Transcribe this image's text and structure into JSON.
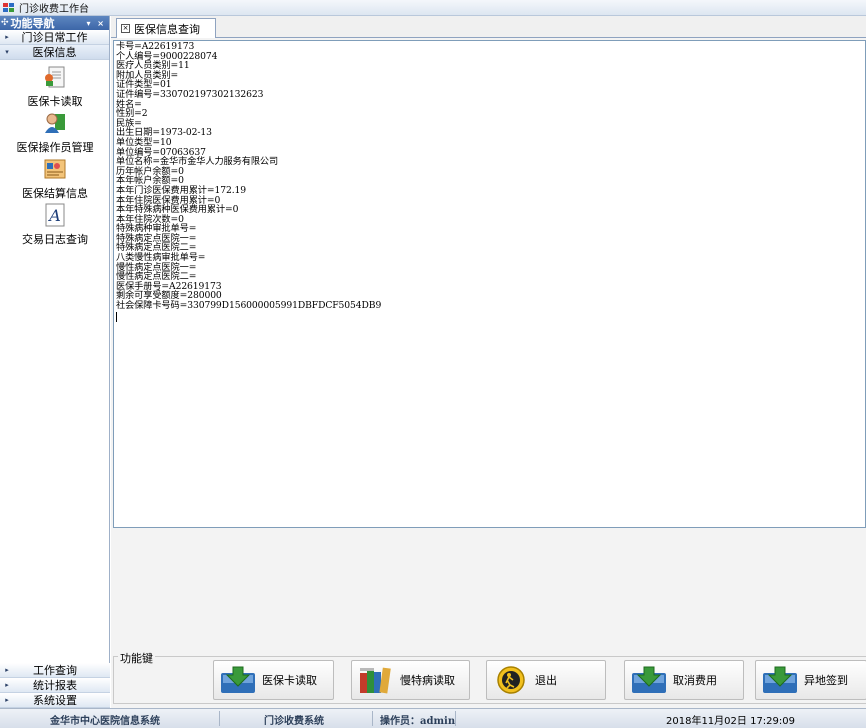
{
  "window": {
    "title": "门诊收费工作台"
  },
  "nav": {
    "header": "功能导航",
    "header_controls": "▾ ×",
    "groups_top": [
      {
        "label": "门诊日常工作",
        "arrow": "▸"
      },
      {
        "label": "医保信息",
        "arrow": "▾"
      }
    ],
    "items": [
      {
        "label": "医保卡读取",
        "icon": "card-reader-icon"
      },
      {
        "label": "医保操作员管理",
        "icon": "operator-icon"
      },
      {
        "label": "医保结算信息",
        "icon": "settlement-icon"
      },
      {
        "label": "交易日志查询",
        "icon": "log-query-icon"
      }
    ],
    "groups_bottom": [
      {
        "label": "工作查询",
        "arrow": "▸"
      },
      {
        "label": "统计报表",
        "arrow": "▸"
      },
      {
        "label": "系统设置",
        "arrow": "▸"
      }
    ]
  },
  "tab": {
    "label": "医保信息查询",
    "close": "×"
  },
  "info_lines": [
    "卡号=A22619173",
    "个人编号=9000228074",
    "医疗人员类别=11",
    "附加人员类别=",
    "证件类型=01",
    "证件编号=330702197302132623",
    "姓名=",
    "性别=2",
    "民族=",
    "出生日期=1973-02-13",
    "单位类型=10",
    "单位编号=07063637",
    "单位名称=金华市金华人力服务有限公司",
    "历年帐户余额=0",
    "本年帐户余额=0",
    "本年门诊医保费用累计=172.19",
    "本年住院医保费用累计=0",
    "本年特殊病种医保费用累计=0",
    "本年住院次数=0",
    "特殊病种审批单号=",
    "特殊病定点医院一=",
    "特殊病定点医院二=",
    "八类慢性病审批单号=",
    "慢性病定点医院一=",
    "慢性病定点医院二=",
    "医保手册号=A22619173",
    "剩余可享受额度=280000",
    "社会保障卡号码=330799D156000005991DBFDCF5054DB9"
  ],
  "function_panel": {
    "legend": "功能键",
    "buttons": [
      {
        "label": "医保卡读取",
        "icon": "download-arrow-icon"
      },
      {
        "label": "慢特病读取",
        "icon": "books-icon"
      },
      {
        "label": "退出",
        "icon": "exit-icon"
      },
      {
        "label": "取消费用",
        "icon": "download-arrow-icon"
      },
      {
        "label": "异地签到",
        "icon": "download-arrow-icon"
      }
    ]
  },
  "status": {
    "hospital": "金华市中心医院信息系统",
    "system": "门诊收费系统",
    "operator": "操作员：admin",
    "datetime": "2018年11月02日  17:29:09"
  },
  "colors": {
    "nav_header": "#4a74b4",
    "accent_green": "#3a9a3a",
    "accent_blue": "#2f6fb8"
  }
}
